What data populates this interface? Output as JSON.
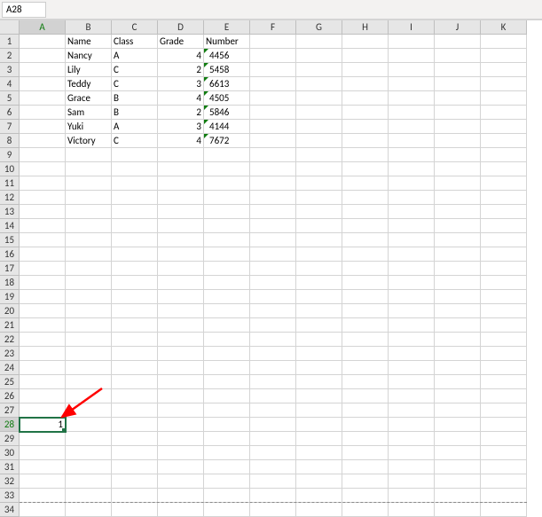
{
  "namebox": {
    "value": "A28"
  },
  "columns": [
    "A",
    "B",
    "C",
    "D",
    "E",
    "F",
    "G",
    "H",
    "I",
    "J",
    "K"
  ],
  "rows": 34,
  "headers": {
    "b": "Name",
    "c": "Class",
    "d": "Grade",
    "e": "Number"
  },
  "data": [
    {
      "name": "Nancy",
      "class": "A",
      "grade": "4",
      "number": "4456"
    },
    {
      "name": "Lily",
      "class": "C",
      "grade": "2",
      "number": "5458"
    },
    {
      "name": "Teddy",
      "class": "C",
      "grade": "3",
      "number": "6613"
    },
    {
      "name": "Grace",
      "class": "B",
      "grade": "4",
      "number": "4505"
    },
    {
      "name": "Sam",
      "class": "B",
      "grade": "2",
      "number": "5846"
    },
    {
      "name": "Yuki",
      "class": "A",
      "grade": "3",
      "number": "4144"
    },
    {
      "name": "Victory",
      "class": "C",
      "grade": "4",
      "number": "7672"
    }
  ],
  "selected": {
    "col": "A",
    "row": 28,
    "value": "1"
  },
  "pagebreak_row": 33
}
